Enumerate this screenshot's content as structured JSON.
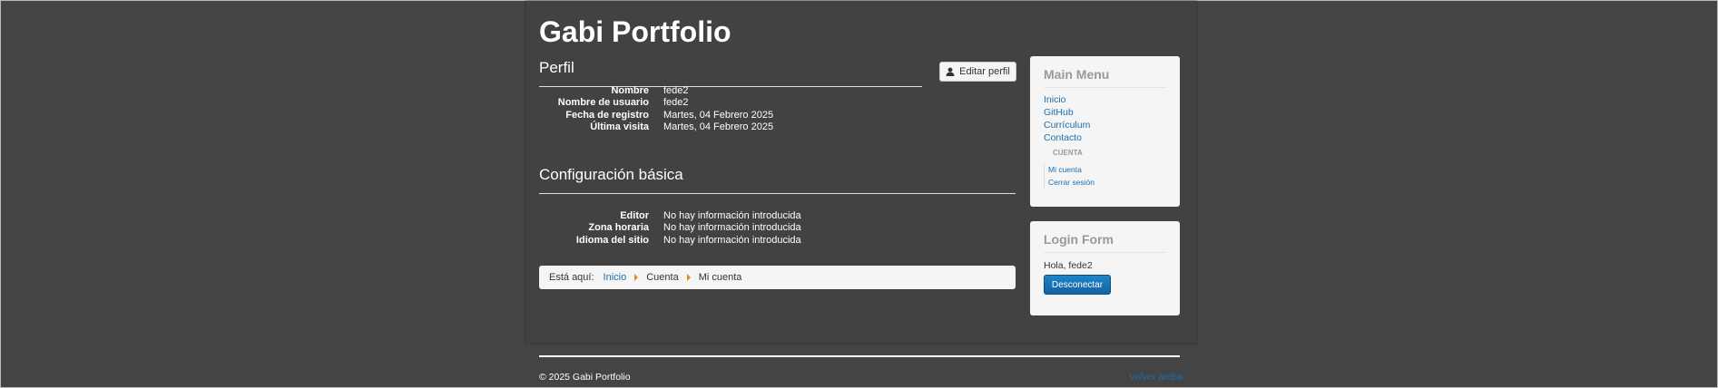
{
  "site": {
    "title": "Gabi Portfolio"
  },
  "profile": {
    "heading": "Perfil",
    "edit_label": "Editar perfil",
    "fields": [
      {
        "label": "Nombre",
        "value": "fede2"
      },
      {
        "label": "Nombre de usuario",
        "value": "fede2"
      },
      {
        "label": "Fecha de registro",
        "value": "Martes, 04 Febrero 2025"
      },
      {
        "label": "Última visita",
        "value": "Martes, 04 Febrero 2025"
      }
    ]
  },
  "basic_settings": {
    "heading": "Configuración básica",
    "fields": [
      {
        "label": "Editor",
        "value": "No hay información introducida"
      },
      {
        "label": "Zona horaria",
        "value": "No hay información introducida"
      },
      {
        "label": "Idioma del sitio",
        "value": "No hay información introducida"
      }
    ]
  },
  "breadcrumb": {
    "prefix": "Está aquí:",
    "items": [
      "Inicio",
      "Cuenta",
      "Mi cuenta"
    ]
  },
  "main_menu": {
    "title": "Main Menu",
    "items": [
      "Inicio",
      "GitHub",
      "Currículum",
      "Contacto"
    ],
    "submenu_heading": "CUENTA",
    "submenu_items": [
      "Mi cuenta",
      "Cerrar sesión"
    ]
  },
  "login_form": {
    "title": "Login Form",
    "greeting": "Hola, fede2",
    "logout_label": "Desconectar"
  },
  "footer": {
    "copyright": "© 2025 Gabi Portfolio",
    "back_to_top": "Volver arriba"
  },
  "colors": {
    "background": "#444444",
    "link": "#1a6fb0",
    "breadcrumb_separator": "#e48c1e",
    "button_primary": "#1a6fb0"
  }
}
